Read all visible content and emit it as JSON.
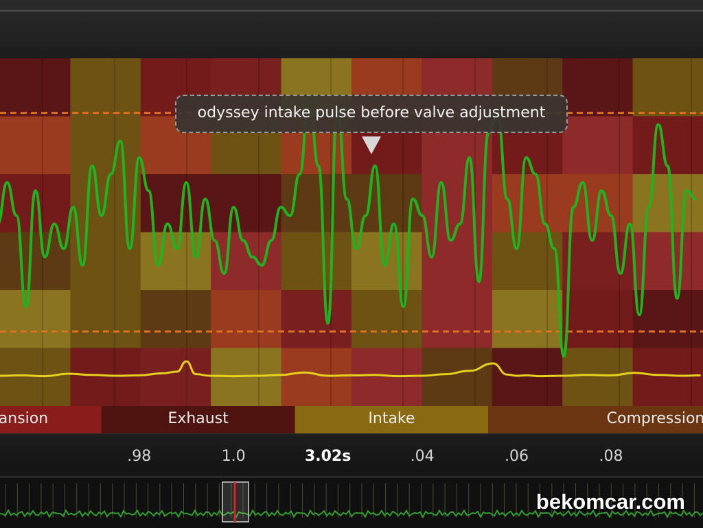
{
  "annotation": {
    "text": "odyssey intake pulse before valve adjustment"
  },
  "brand": {
    "text": "bekomcar.com"
  },
  "colors": {
    "pressure": "#1fb41f",
    "secondary": "#e6d21e",
    "threshold": "#e0701c",
    "playhead": "#e02020"
  },
  "chart_data": {
    "type": "line",
    "x_unit": "s",
    "xlim": [
      2.9505,
      3.0995
    ],
    "tick_labels": [
      {
        "x": 2.98,
        "label": ".98"
      },
      {
        "x": 3.0,
        "label": "1.0"
      },
      {
        "x": 3.02,
        "label": "3.02s",
        "current": true
      },
      {
        "x": 3.04,
        "label": ".04"
      },
      {
        "x": 3.06,
        "label": ".06"
      },
      {
        "x": 3.08,
        "label": ".08"
      }
    ],
    "phases": [
      {
        "label": "Expansion",
        "shown_label": "ansion",
        "start": 2.95,
        "end": 2.972,
        "color": "#8a1c1c"
      },
      {
        "label": "Exhaust",
        "start": 2.972,
        "end": 3.013,
        "color": "#4f1410"
      },
      {
        "label": "Intake",
        "start": 3.013,
        "end": 3.054,
        "color": "#8a6a10"
      },
      {
        "label": "Compression",
        "start": 3.054,
        "end": 3.1,
        "color": "#6a3510"
      }
    ],
    "thresholds": [
      {
        "y": 0.72
      },
      {
        "y": -0.6
      }
    ],
    "series": [
      {
        "x": [
          2.95,
          2.952,
          2.954,
          2.956,
          2.958,
          2.96,
          2.962,
          2.964,
          2.966,
          2.968,
          2.97,
          2.972,
          2.974,
          2.976,
          2.978,
          2.98,
          2.982,
          2.984,
          2.986,
          2.988,
          2.99,
          2.992,
          2.994,
          2.996,
          2.998,
          3.0,
          3.002,
          3.004,
          3.006,
          3.008,
          3.01,
          3.012,
          3.014,
          3.016,
          3.018,
          3.02,
          3.022,
          3.024,
          3.026,
          3.028,
          3.03,
          3.032,
          3.034,
          3.036,
          3.038,
          3.04,
          3.042,
          3.044,
          3.046,
          3.048,
          3.05,
          3.052,
          3.054,
          3.056,
          3.058,
          3.06,
          3.062,
          3.064,
          3.066,
          3.068,
          3.07,
          3.072,
          3.074,
          3.076,
          3.078,
          3.08,
          3.082,
          3.084,
          3.086,
          3.088,
          3.09,
          3.092,
          3.094,
          3.096,
          3.098
        ],
        "y": [
          0.05,
          0.3,
          0.1,
          -0.45,
          0.25,
          -0.15,
          0.05,
          -0.1,
          0.15,
          -0.2,
          0.4,
          0.1,
          0.35,
          0.55,
          -0.1,
          0.45,
          0.25,
          -0.2,
          0.05,
          -0.1,
          0.3,
          -0.15,
          0.2,
          -0.05,
          -0.25,
          0.15,
          -0.05,
          -0.15,
          -0.2,
          -0.05,
          0.15,
          0.1,
          0.35,
          0.8,
          0.4,
          -0.55,
          0.75,
          0.2,
          -0.1,
          0.1,
          0.4,
          -0.2,
          0.05,
          -0.45,
          0.2,
          0.1,
          -0.15,
          0.3,
          -0.05,
          0.05,
          0.45,
          -0.3,
          0.6,
          0.7,
          0.2,
          -0.1,
          0.45,
          0.35,
          0.05,
          -0.1,
          -0.75,
          0.15,
          0.3,
          -0.05,
          0.25,
          0.1,
          -0.25,
          0.05,
          -0.5,
          0.15,
          0.65,
          0.4,
          -0.4,
          0.25,
          0.2
        ],
        "ylim": [
          -1.05,
          1.05
        ]
      },
      {
        "x": [
          2.95,
          2.955,
          2.96,
          2.965,
          2.97,
          2.975,
          2.98,
          2.985,
          2.988,
          2.99,
          2.992,
          2.995,
          3.0,
          3.005,
          3.01,
          3.015,
          3.02,
          3.025,
          3.03,
          3.035,
          3.04,
          3.045,
          3.05,
          3.055,
          3.058,
          3.06,
          3.062,
          3.065,
          3.07,
          3.075,
          3.08,
          3.085,
          3.09,
          3.095,
          3.099
        ],
        "y": [
          0.0,
          0.01,
          -0.01,
          0.05,
          0.02,
          0.0,
          0.01,
          0.06,
          0.1,
          0.35,
          0.04,
          0.0,
          -0.01,
          0.0,
          0.02,
          0.08,
          0.0,
          0.01,
          0.02,
          -0.01,
          0.0,
          0.04,
          0.12,
          0.3,
          0.03,
          0.0,
          0.01,
          -0.01,
          0.0,
          0.02,
          0.01,
          0.07,
          0.02,
          0.0,
          0.01
        ],
        "ylim": [
          -0.2,
          0.8
        ]
      }
    ]
  }
}
